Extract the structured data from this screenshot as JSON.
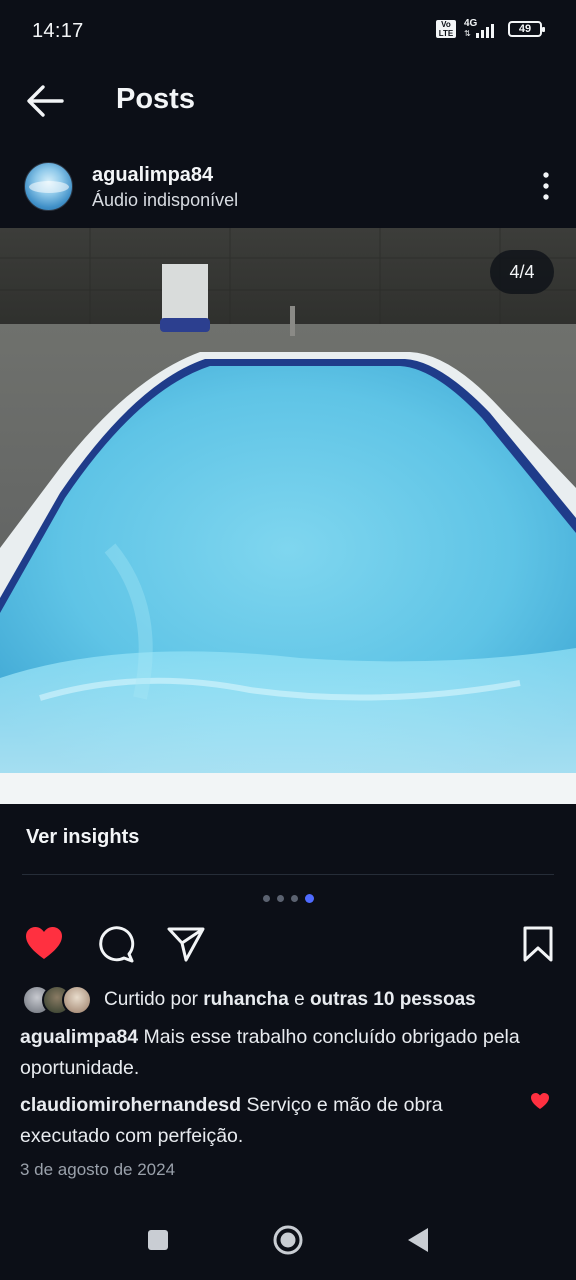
{
  "status_bar": {
    "time": "14:17",
    "volte": "Vo LTE",
    "network": "4G",
    "battery": "49"
  },
  "header": {
    "title": "Posts"
  },
  "post": {
    "username": "agualimpa84",
    "audio_status": "Áudio indisponível",
    "carousel_counter": "4/4",
    "insights_label": "Ver insights",
    "carousel": {
      "total": 4,
      "active": 4
    },
    "likes": {
      "prefix": "Curtido por ",
      "user": "ruhancha",
      "connector": " e ",
      "others": "outras 10 pessoas"
    },
    "caption": {
      "user": "agualimpa84",
      "text": " Mais esse trabalho concluído obrigado pela oportunidade."
    },
    "comment": {
      "user": "claudiomirohernandesd",
      "text": " Serviço e mão de obra executado com perfeição."
    },
    "date": "3 de agosto de 2024"
  },
  "colors": {
    "background": "#0c0f17",
    "like_red": "#ff3040",
    "active_dot": "#4f6bff"
  },
  "icons": [
    "back-arrow-icon",
    "more-options-icon",
    "heart-icon",
    "comment-icon",
    "share-icon",
    "bookmark-icon",
    "nav-recents-icon",
    "nav-home-icon",
    "nav-back-icon"
  ]
}
